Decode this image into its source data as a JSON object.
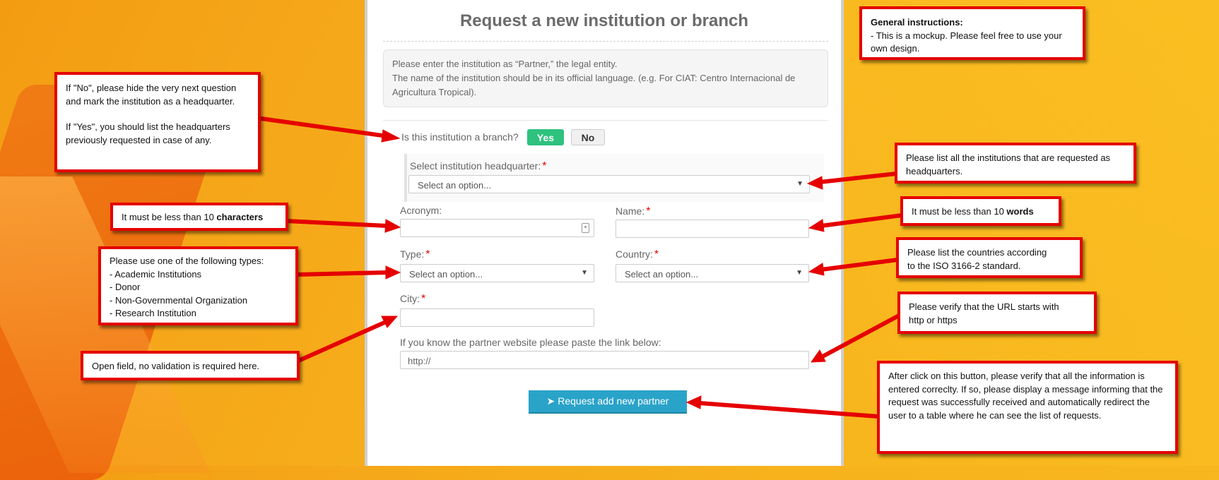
{
  "form": {
    "title": "Request a new institution or branch",
    "info_lines": [
      "Please enter the institution as “Partner,” the legal entity.",
      "The name of the institution should be in its official language. (e.g. For CIAT: Centro Internacional de Agricultura Tropical)."
    ],
    "branch_question": "Is this institution a branch?",
    "yes_label": "Yes",
    "no_label": "No",
    "hq_label": "Select institution headquarter:",
    "hq_placeholder": "Select an option...",
    "acronym_label": "Acronym:",
    "name_label": "Name:",
    "type_label": "Type:",
    "type_placeholder": "Select an option...",
    "country_label": "Country:",
    "country_placeholder": "Select an option...",
    "city_label": "City:",
    "website_label": "If you know the partner website please paste the link below:",
    "website_value": "http://",
    "required_mark": "*",
    "submit_label": "Request add new partner"
  },
  "notes": {
    "general_title": "General instructions:",
    "general_text": "- This is a mockup. Please feel free to use your own design.",
    "branch_note": [
      "If \"No\", please hide the very next question and mark the institution as a headquarter.",
      "",
      "If \"Yes\", you should list the headquarters previously requested in case of any."
    ],
    "acronym_note_prefix": "It must be less than 10 ",
    "acronym_note_bold": "characters",
    "type_note": [
      "Please use one of the following types:",
      "- Academic Institutions",
      "- Donor",
      "- Non-Governmental Organization",
      "- Research Institution"
    ],
    "city_note": "Open field, no validation is required here.",
    "hq_note": "Please list all the institutions that are requested as headquarters.",
    "name_note_prefix": "It must be less than 10 ",
    "name_note_bold": "words",
    "country_note": [
      "Please list the countries according",
      "to the ISO 3166-2 standard."
    ],
    "url_note": [
      "Please verify that the URL starts with",
      "http or https"
    ],
    "submit_note": "After click on this button, please verify that all the information is entered correclty. If so, please display a message informing that the request was successfully received and automatically redirect the user to a table where he can see the list of requests."
  },
  "colors": {
    "accent_green": "#2ec27e",
    "submit_blue": "#2aa3c9",
    "annotation_red": "#e50000",
    "required_red": "#e60000"
  }
}
